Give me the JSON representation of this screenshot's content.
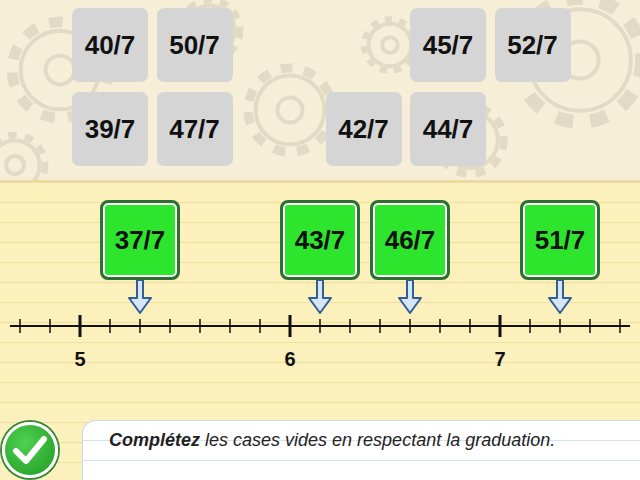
{
  "tray": [
    {
      "label": "40/7"
    },
    {
      "label": "50/7"
    },
    {
      "label": "45/7"
    },
    {
      "label": "52/7"
    },
    {
      "label": "39/7"
    },
    {
      "label": "47/7"
    },
    {
      "label": "42/7"
    },
    {
      "label": "44/7"
    }
  ],
  "placed": [
    {
      "label": "37/7"
    },
    {
      "label": "43/7"
    },
    {
      "label": "46/7"
    },
    {
      "label": "51/7"
    }
  ],
  "axis": {
    "labels": [
      "5",
      "6",
      "7"
    ]
  },
  "instruction": {
    "emphasis": "Complétez",
    "text": "les cases vides en respectant la graduation."
  }
}
